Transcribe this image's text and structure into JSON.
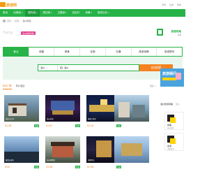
{
  "top": {
    "logo_text": "旅游网",
    "links": [
      "登录",
      "注册",
      "帮助"
    ]
  },
  "nav": [
    {
      "label": "首页",
      "active": false
    },
    {
      "label": "出境游",
      "active": false
    },
    {
      "label": "国内游",
      "active": true
    },
    {
      "label": "周边游",
      "active": false
    },
    {
      "label": "主题游",
      "active": false
    },
    {
      "label": "自由行",
      "active": false
    },
    {
      "label": "攻略",
      "active": false
    },
    {
      "label": "旅游社区",
      "active": false
    }
  ],
  "breadcrumb": [
    "首页",
    "旅游",
    "温州旅游"
  ],
  "title": {
    "city": "Yuerg",
    "badge": "温州旅游攻略",
    "banner_title": "旅游攻略",
    "banner_sub": "攻略"
  },
  "cat_tabs": [
    "景点",
    "线路",
    "美食",
    "住宿",
    "交通",
    "旅游攻略",
    "旅游顾问"
  ],
  "search": {
    "city": "温州",
    "value": "温州",
    "button": "自由搜索"
  },
  "content_tabs": [
    "热点门票",
    "特价酒店"
  ],
  "more": "更多 >",
  "cards": [
    {
      "price": "¥158",
      "tag": "热销",
      "caption": "温州江心屿"
    },
    {
      "price": "¥192",
      "tag": "热销",
      "caption": "温州乐园"
    },
    {
      "price": "¥116",
      "tag": "热销",
      "caption": "楠溪江景区"
    },
    {
      "price": "¥56",
      "tag": "热销",
      "caption": "雁荡山景区"
    },
    {
      "price": "¥158",
      "tag": "热销",
      "caption": "温州博物馆"
    },
    {
      "price": "¥158",
      "tag": "热销",
      "caption": "南麂列岛"
    }
  ],
  "right": {
    "ad_big": "旅游顾问",
    "title": "温州旅游攻略",
    "more": "更多",
    "cards": [
      {
        "label": "攻略",
        "sub": "温州旅游"
      },
      {
        "label": "旅游",
        "sub": "攻略指南"
      }
    ]
  },
  "colors": {
    "brand_green": "#27b348",
    "accent_orange": "#f58220",
    "badge_pink": "#e0408c"
  }
}
